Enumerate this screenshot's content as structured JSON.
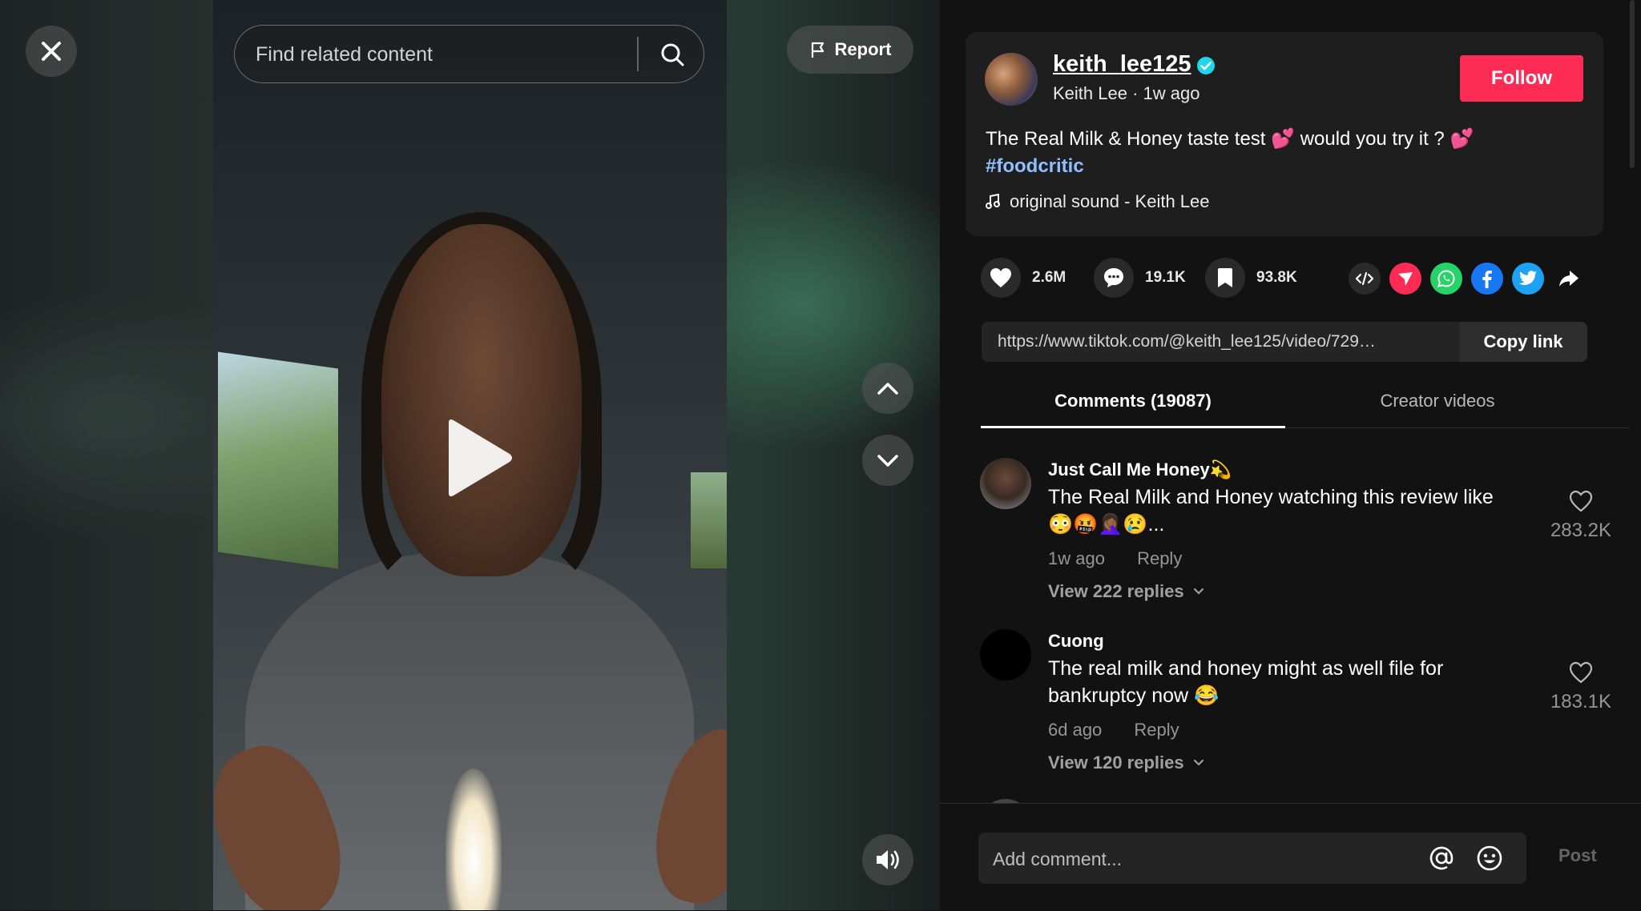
{
  "search": {
    "placeholder": "Find related content"
  },
  "report": {
    "label": "Report"
  },
  "author": {
    "username": "keith_lee125",
    "display_name": "Keith Lee",
    "posted": "1w ago",
    "follow_label": "Follow"
  },
  "post": {
    "description": "The Real Milk & Honey taste test 💕 would you try it ? 💕",
    "hashtag": "#foodcritic",
    "sound": "original sound - Keith Lee"
  },
  "stats": {
    "likes": "2.6M",
    "comments": "19.1K",
    "saves": "93.8K"
  },
  "share_icons": [
    "embed-icon",
    "send-to-friends-icon",
    "whatsapp-icon",
    "facebook-icon",
    "twitter-icon",
    "share-arrow-icon"
  ],
  "link": {
    "url": "https://www.tiktok.com/@keith_lee125/video/729444...",
    "copy_label": "Copy link"
  },
  "tabs": [
    {
      "label": "Comments (19087)",
      "active": true
    },
    {
      "label": "Creator videos",
      "active": false
    }
  ],
  "comments": [
    {
      "user": "Just Call Me Honey💫",
      "text": "The Real Milk and Honey watching this review like 😳🤬🤦🏾‍♀️😢...",
      "time": "1w ago",
      "reply_label": "Reply",
      "view_replies": "View 222 replies",
      "likes": "283.2K"
    },
    {
      "user": "Cuong",
      "text": "The real milk and honey might as well file for bankruptcy now 😂",
      "time": "6d ago",
      "reply_label": "Reply",
      "view_replies": "View 120 replies",
      "likes": "183.1K"
    }
  ],
  "composer": {
    "placeholder": "Add comment...",
    "post_label": "Post"
  },
  "colors": {
    "follow": "#fe2c55",
    "background": "#121212",
    "hashtag": "#8fbfff"
  }
}
